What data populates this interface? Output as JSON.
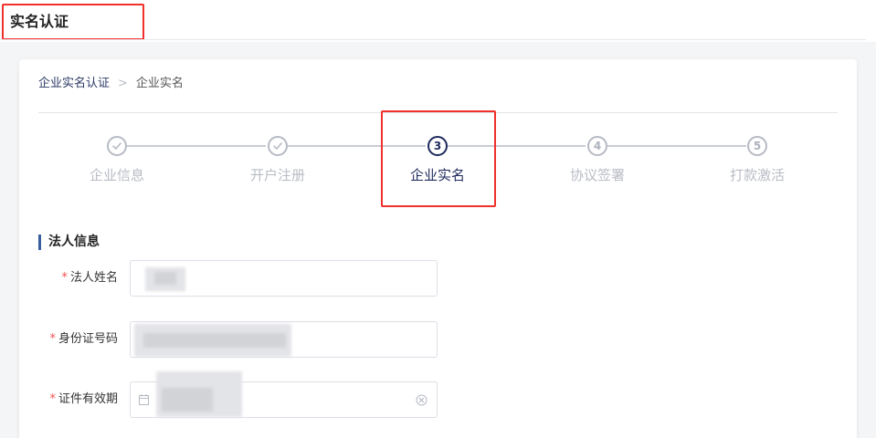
{
  "header": {
    "title": "实名认证"
  },
  "breadcrumb": {
    "parent": "企业实名认证",
    "separator": ">",
    "current": "企业实名"
  },
  "steps": [
    {
      "label": "企业信息",
      "status": "done",
      "number": ""
    },
    {
      "label": "开户注册",
      "status": "done",
      "number": ""
    },
    {
      "label": "企业实名",
      "status": "active",
      "number": "3"
    },
    {
      "label": "协议签署",
      "status": "pending",
      "number": "4"
    },
    {
      "label": "打款激活",
      "status": "pending",
      "number": "5"
    }
  ],
  "section": {
    "title": "法人信息"
  },
  "form": {
    "required_mark": "*",
    "legal_name": {
      "label": "法人姓名",
      "value": ""
    },
    "id_number": {
      "label": "身份证号码",
      "value": ""
    },
    "id_validity": {
      "label": "证件有效期",
      "value": ""
    }
  },
  "colors": {
    "accent": "#1e2a5c",
    "highlight": "#f0302a",
    "required": "#f05050",
    "inactive": "#b9bcc5"
  }
}
